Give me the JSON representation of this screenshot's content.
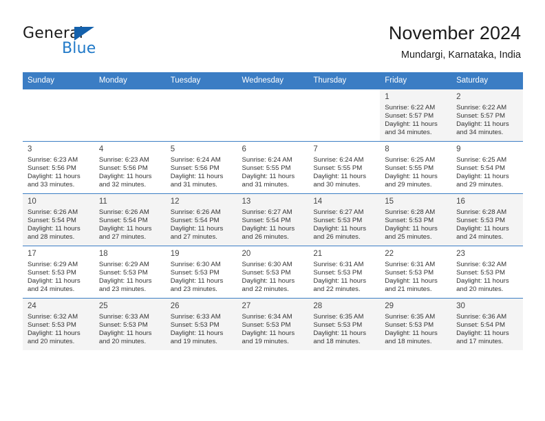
{
  "brand": {
    "word1": "General",
    "word2": "Blue",
    "flag_icon": "blue-triangle-flag-icon",
    "flag_color": "#1461ac",
    "text_color": "#2079c8"
  },
  "header": {
    "title": "November 2024",
    "subtitle": "Mundargi, Karnataka, India"
  },
  "theme": {
    "header_row_bg": "#3b7dc4",
    "header_row_text": "#ffffff",
    "cell_border": "#3b7dc4",
    "week_shade_bg": "#f4f4f4",
    "week_plain_bg": "#ffffff"
  },
  "calendar": {
    "weekday_headers": [
      "Sunday",
      "Monday",
      "Tuesday",
      "Wednesday",
      "Thursday",
      "Friday",
      "Saturday"
    ],
    "weeks": [
      [
        {
          "day": "",
          "lines": []
        },
        {
          "day": "",
          "lines": []
        },
        {
          "day": "",
          "lines": []
        },
        {
          "day": "",
          "lines": []
        },
        {
          "day": "",
          "lines": []
        },
        {
          "day": "1",
          "lines": [
            "Sunrise: 6:22 AM",
            "Sunset: 5:57 PM",
            "Daylight: 11 hours",
            "and 34 minutes."
          ]
        },
        {
          "day": "2",
          "lines": [
            "Sunrise: 6:22 AM",
            "Sunset: 5:57 PM",
            "Daylight: 11 hours",
            "and 34 minutes."
          ]
        }
      ],
      [
        {
          "day": "3",
          "lines": [
            "Sunrise: 6:23 AM",
            "Sunset: 5:56 PM",
            "Daylight: 11 hours",
            "and 33 minutes."
          ]
        },
        {
          "day": "4",
          "lines": [
            "Sunrise: 6:23 AM",
            "Sunset: 5:56 PM",
            "Daylight: 11 hours",
            "and 32 minutes."
          ]
        },
        {
          "day": "5",
          "lines": [
            "Sunrise: 6:24 AM",
            "Sunset: 5:56 PM",
            "Daylight: 11 hours",
            "and 31 minutes."
          ]
        },
        {
          "day": "6",
          "lines": [
            "Sunrise: 6:24 AM",
            "Sunset: 5:55 PM",
            "Daylight: 11 hours",
            "and 31 minutes."
          ]
        },
        {
          "day": "7",
          "lines": [
            "Sunrise: 6:24 AM",
            "Sunset: 5:55 PM",
            "Daylight: 11 hours",
            "and 30 minutes."
          ]
        },
        {
          "day": "8",
          "lines": [
            "Sunrise: 6:25 AM",
            "Sunset: 5:55 PM",
            "Daylight: 11 hours",
            "and 29 minutes."
          ]
        },
        {
          "day": "9",
          "lines": [
            "Sunrise: 6:25 AM",
            "Sunset: 5:54 PM",
            "Daylight: 11 hours",
            "and 29 minutes."
          ]
        }
      ],
      [
        {
          "day": "10",
          "lines": [
            "Sunrise: 6:26 AM",
            "Sunset: 5:54 PM",
            "Daylight: 11 hours",
            "and 28 minutes."
          ]
        },
        {
          "day": "11",
          "lines": [
            "Sunrise: 6:26 AM",
            "Sunset: 5:54 PM",
            "Daylight: 11 hours",
            "and 27 minutes."
          ]
        },
        {
          "day": "12",
          "lines": [
            "Sunrise: 6:26 AM",
            "Sunset: 5:54 PM",
            "Daylight: 11 hours",
            "and 27 minutes."
          ]
        },
        {
          "day": "13",
          "lines": [
            "Sunrise: 6:27 AM",
            "Sunset: 5:54 PM",
            "Daylight: 11 hours",
            "and 26 minutes."
          ]
        },
        {
          "day": "14",
          "lines": [
            "Sunrise: 6:27 AM",
            "Sunset: 5:53 PM",
            "Daylight: 11 hours",
            "and 26 minutes."
          ]
        },
        {
          "day": "15",
          "lines": [
            "Sunrise: 6:28 AM",
            "Sunset: 5:53 PM",
            "Daylight: 11 hours",
            "and 25 minutes."
          ]
        },
        {
          "day": "16",
          "lines": [
            "Sunrise: 6:28 AM",
            "Sunset: 5:53 PM",
            "Daylight: 11 hours",
            "and 24 minutes."
          ]
        }
      ],
      [
        {
          "day": "17",
          "lines": [
            "Sunrise: 6:29 AM",
            "Sunset: 5:53 PM",
            "Daylight: 11 hours",
            "and 24 minutes."
          ]
        },
        {
          "day": "18",
          "lines": [
            "Sunrise: 6:29 AM",
            "Sunset: 5:53 PM",
            "Daylight: 11 hours",
            "and 23 minutes."
          ]
        },
        {
          "day": "19",
          "lines": [
            "Sunrise: 6:30 AM",
            "Sunset: 5:53 PM",
            "Daylight: 11 hours",
            "and 23 minutes."
          ]
        },
        {
          "day": "20",
          "lines": [
            "Sunrise: 6:30 AM",
            "Sunset: 5:53 PM",
            "Daylight: 11 hours",
            "and 22 minutes."
          ]
        },
        {
          "day": "21",
          "lines": [
            "Sunrise: 6:31 AM",
            "Sunset: 5:53 PM",
            "Daylight: 11 hours",
            "and 22 minutes."
          ]
        },
        {
          "day": "22",
          "lines": [
            "Sunrise: 6:31 AM",
            "Sunset: 5:53 PM",
            "Daylight: 11 hours",
            "and 21 minutes."
          ]
        },
        {
          "day": "23",
          "lines": [
            "Sunrise: 6:32 AM",
            "Sunset: 5:53 PM",
            "Daylight: 11 hours",
            "and 20 minutes."
          ]
        }
      ],
      [
        {
          "day": "24",
          "lines": [
            "Sunrise: 6:32 AM",
            "Sunset: 5:53 PM",
            "Daylight: 11 hours",
            "and 20 minutes."
          ]
        },
        {
          "day": "25",
          "lines": [
            "Sunrise: 6:33 AM",
            "Sunset: 5:53 PM",
            "Daylight: 11 hours",
            "and 20 minutes."
          ]
        },
        {
          "day": "26",
          "lines": [
            "Sunrise: 6:33 AM",
            "Sunset: 5:53 PM",
            "Daylight: 11 hours",
            "and 19 minutes."
          ]
        },
        {
          "day": "27",
          "lines": [
            "Sunrise: 6:34 AM",
            "Sunset: 5:53 PM",
            "Daylight: 11 hours",
            "and 19 minutes."
          ]
        },
        {
          "day": "28",
          "lines": [
            "Sunrise: 6:35 AM",
            "Sunset: 5:53 PM",
            "Daylight: 11 hours",
            "and 18 minutes."
          ]
        },
        {
          "day": "29",
          "lines": [
            "Sunrise: 6:35 AM",
            "Sunset: 5:53 PM",
            "Daylight: 11 hours",
            "and 18 minutes."
          ]
        },
        {
          "day": "30",
          "lines": [
            "Sunrise: 6:36 AM",
            "Sunset: 5:54 PM",
            "Daylight: 11 hours",
            "and 17 minutes."
          ]
        }
      ]
    ]
  }
}
